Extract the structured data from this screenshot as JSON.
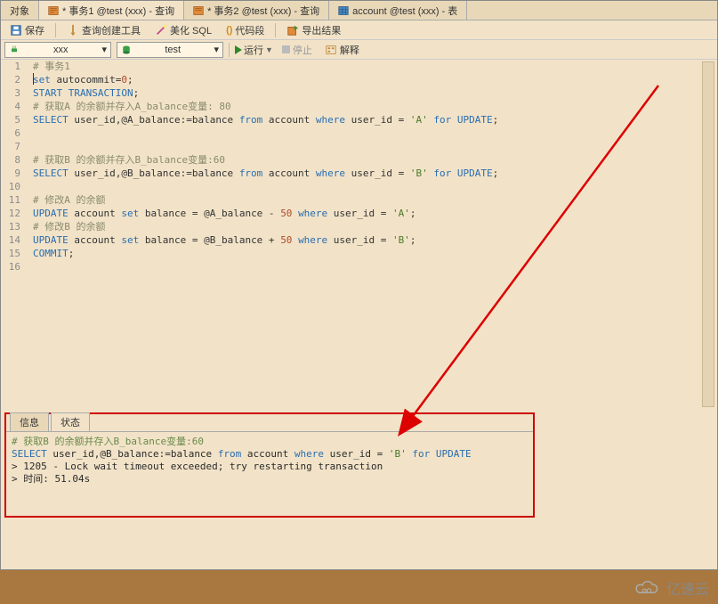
{
  "tabs": [
    {
      "label": "对象",
      "icon": "object"
    },
    {
      "label": "* 事务1 @test (xxx) - 查询",
      "icon": "query",
      "active": true
    },
    {
      "label": "* 事务2 @test (xxx) - 查询",
      "icon": "query"
    },
    {
      "label": "account @test (xxx) - 表",
      "icon": "table"
    }
  ],
  "toolbar": {
    "save": "保存",
    "query_builder": "查询创建工具",
    "beautify": "美化 SQL",
    "snippet": "代码段",
    "export": "导出结果"
  },
  "conn_bar": {
    "conn_label": "xxx",
    "db_label": "test",
    "run": "运行",
    "stop": "停止",
    "explain": "解释"
  },
  "editor_lines": [
    {
      "n": 1,
      "s": [
        [
          "c",
          "# 事务1"
        ]
      ]
    },
    {
      "n": 2,
      "s": [
        [
          "k",
          "set"
        ],
        [
          "p",
          " autocommit"
        ],
        [
          "o",
          "="
        ],
        [
          "n",
          "0"
        ],
        [
          "p",
          ";"
        ]
      ]
    },
    {
      "n": 3,
      "s": [
        [
          "k",
          "START TRANSACTION"
        ],
        [
          "p",
          ";"
        ]
      ]
    },
    {
      "n": 4,
      "s": [
        [
          "c",
          "# 获取A 的余额并存入A_balance变量: 80"
        ]
      ]
    },
    {
      "n": 5,
      "s": [
        [
          "k",
          "SELECT"
        ],
        [
          "p",
          " user_id,@A_balance:=balance "
        ],
        [
          "k",
          "from"
        ],
        [
          "p",
          " account "
        ],
        [
          "k",
          "where"
        ],
        [
          "p",
          " user_id = "
        ],
        [
          "s",
          "'A'"
        ],
        [
          "p",
          " "
        ],
        [
          "k",
          "for UPDATE"
        ],
        [
          "p",
          ";"
        ]
      ]
    },
    {
      "n": 6,
      "s": []
    },
    {
      "n": 7,
      "s": []
    },
    {
      "n": 8,
      "s": [
        [
          "c",
          "# 获取B 的余额并存入B_balance变量:60"
        ]
      ]
    },
    {
      "n": 9,
      "s": [
        [
          "k",
          "SELECT"
        ],
        [
          "p",
          " user_id,@B_balance:=balance "
        ],
        [
          "k",
          "from"
        ],
        [
          "p",
          " account "
        ],
        [
          "k",
          "where"
        ],
        [
          "p",
          " user_id = "
        ],
        [
          "s",
          "'B'"
        ],
        [
          "p",
          " "
        ],
        [
          "k",
          "for UPDATE"
        ],
        [
          "p",
          ";"
        ]
      ]
    },
    {
      "n": 10,
      "s": []
    },
    {
      "n": 11,
      "s": [
        [
          "c",
          "# 修改A 的余额"
        ]
      ]
    },
    {
      "n": 12,
      "s": [
        [
          "k",
          "UPDATE"
        ],
        [
          "p",
          " account "
        ],
        [
          "k",
          "set"
        ],
        [
          "p",
          " balance = @A_balance - "
        ],
        [
          "n",
          "50"
        ],
        [
          "p",
          " "
        ],
        [
          "k",
          "where"
        ],
        [
          "p",
          " user_id = "
        ],
        [
          "s",
          "'A'"
        ],
        [
          "p",
          ";"
        ]
      ]
    },
    {
      "n": 13,
      "s": [
        [
          "c",
          "# 修改B 的余额"
        ]
      ]
    },
    {
      "n": 14,
      "s": [
        [
          "k",
          "UPDATE"
        ],
        [
          "p",
          " account "
        ],
        [
          "k",
          "set"
        ],
        [
          "p",
          " balance = @B_balance + "
        ],
        [
          "n",
          "50"
        ],
        [
          "p",
          " "
        ],
        [
          "k",
          "where"
        ],
        [
          "p",
          " user_id = "
        ],
        [
          "s",
          "'B'"
        ],
        [
          "p",
          ";"
        ]
      ]
    },
    {
      "n": 15,
      "s": [
        [
          "k",
          "COMMIT"
        ],
        [
          "p",
          ";"
        ]
      ]
    },
    {
      "n": 16,
      "s": []
    }
  ],
  "bottom": {
    "tab_info": "信息",
    "tab_status": "状态",
    "log1": "# 获取B 的余额并存入B_balance变量:60",
    "log2_pre": "SELECT user_id,@B_balance:=balance from account where user_id = 'B' for UPDATE",
    "log3": "> 1205 - Lock wait timeout exceeded; try restarting transaction",
    "log4": "> 时间: 51.04s"
  },
  "watermark_text": "亿速云"
}
